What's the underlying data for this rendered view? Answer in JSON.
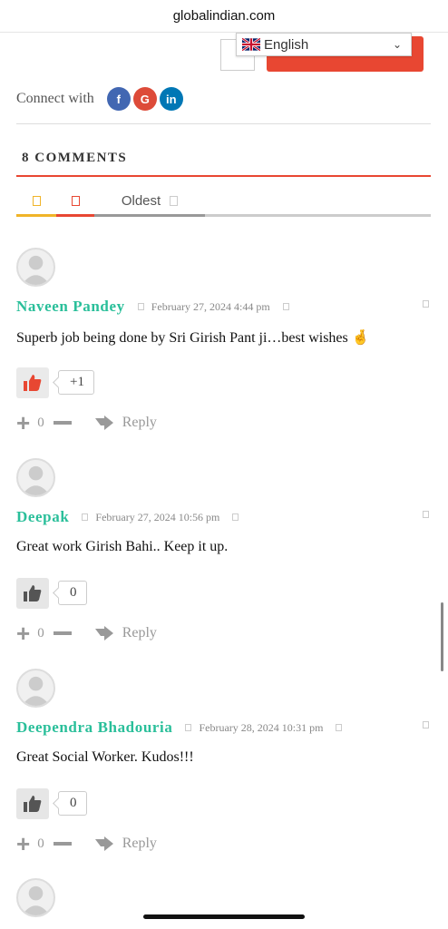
{
  "browser": {
    "url": "globalindian.com"
  },
  "language": {
    "selected": "English"
  },
  "connect": {
    "label": "Connect with",
    "networks": [
      "f",
      "G",
      "in"
    ]
  },
  "comments_header": {
    "title": "8 COMMENTS"
  },
  "tabs": [
    {
      "label": ""
    },
    {
      "label": ""
    },
    {
      "label": "Oldest"
    }
  ],
  "colors": {
    "accent": "#e84732",
    "author": "#2abf9a",
    "tab_yellow": "#f0b429",
    "tab_red": "#e84732",
    "tab_gray": "#999999"
  },
  "comments": [
    {
      "author": "Naveen Pandey",
      "date": "February 27, 2024 4:44 pm",
      "text": "Superb job being done by Sri Girish Pant ji…best wishes",
      "emoji": "🤞",
      "likes": "+1",
      "liked": true,
      "votes": "0",
      "reply": "Reply"
    },
    {
      "author": "Deepak",
      "date": "February 27, 2024 10:56 pm",
      "text": "Great work Girish Bahi.. Keep it up.",
      "emoji": "",
      "likes": "0",
      "liked": false,
      "votes": "0",
      "reply": "Reply"
    },
    {
      "author": "Deependra Bhadouria",
      "date": "February 28, 2024 10:31 pm",
      "text": "Great Social Worker. Kudos!!!",
      "emoji": "",
      "likes": "0",
      "liked": false,
      "votes": "0",
      "reply": "Reply"
    }
  ]
}
